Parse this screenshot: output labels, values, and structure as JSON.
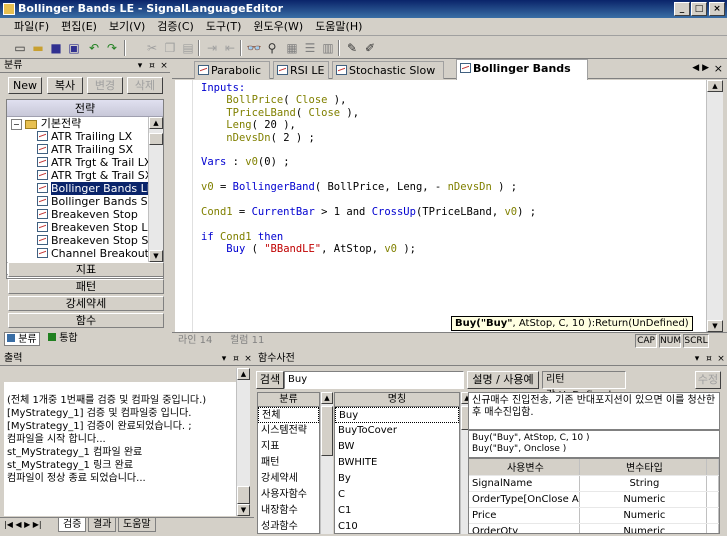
{
  "window": {
    "title": "Bollinger Bands LE - SignalLanguageEditor",
    "controls": [
      "_",
      "□",
      "×"
    ]
  },
  "menu": [
    "파일(F)",
    "편집(E)",
    "보기(V)",
    "검증(C)",
    "도구(T)",
    "윈도우(W)",
    "도움말(H)"
  ],
  "toolbar": [
    "new-file",
    "open",
    "save",
    "save-all",
    "undo",
    "redo",
    "cut",
    "copy",
    "paste",
    "indent",
    "outdent",
    "find",
    "find-next",
    "compile",
    "list",
    "window",
    "pen",
    "pen2"
  ],
  "left": {
    "title": "분류",
    "buttons": {
      "new": "New",
      "copy": "복사",
      "edit": "변경",
      "delete": "삭제"
    },
    "tree_header": "전략",
    "folder": "기본전략",
    "items": [
      "ATR Trailing LX",
      "ATR Trailing SX",
      "ATR Trgt & Trail LX",
      "ATR Trgt & Trail SX",
      "Bollinger Bands LE",
      "Bollinger Bands SE",
      "Breakeven Stop",
      "Breakeven Stop LX",
      "Breakeven Stop SX",
      "Channel Breakout LE"
    ],
    "selected_index": 4,
    "categories": [
      "지표",
      "패턴",
      "강세약세",
      "함수"
    ],
    "bottom_tabs": [
      "분류",
      "통합"
    ]
  },
  "editor": {
    "tabs": [
      "Parabolic LE",
      "RSI LE",
      "Stochastic Slow LE",
      "Bollinger Bands LE"
    ],
    "active_tab": 3,
    "tooltip_bold": "Buy(\"Buy\"",
    "tooltip_rest": ", AtStop, C, 10 ):Return(UnDefined)",
    "status": {
      "line": "라인 14",
      "col": "컬럼 11",
      "caps": "CAP",
      "num": "NUM",
      "scrl": "SCRL"
    }
  },
  "output": {
    "title": "출력",
    "lines": [
      "(전체 1개중 1번째를 검증 및 컴파일 중입니다.)",
      "[MyStrategy_1] 검증 및 컴파일중 입니다.",
      "[MyStrategy_1] 검증이 완료되었습니다. ;",
      "컴파일을 시작 합니다...",
      "st_MyStrategy_1 컴파일 완료",
      "st_MyStrategy_1 링크 완료",
      "컴파일이 정상 종료 되었습니다..."
    ],
    "tabs": [
      "검증",
      "결과",
      "도움말"
    ]
  },
  "func": {
    "title": "함수사전",
    "search_label": "검색",
    "search_value": "Buy",
    "desc_button": "설명 / 사용예",
    "return_label": "리턴값:UnDefined",
    "edit_button": "수정",
    "cat_header": "분류",
    "name_header": "명칭",
    "categories": [
      "전체",
      "시스템전략",
      "지표",
      "패턴",
      "강세약세",
      "사용자함수",
      "내장함수",
      "성과함수"
    ],
    "names": [
      "Buy",
      "BuyToCover",
      "BW",
      "BWHITE",
      "By",
      "C",
      "C1",
      "C10"
    ],
    "description": "신규매수 진입전송, 기존 반대포지션이 있으면 이를 청산한 후 매수진입함.",
    "examples": [
      "Buy(\"Buy\", AtStop, C, 10 )",
      "Buy(\"Buy\", Onclose )"
    ],
    "param_headers": [
      "사용변수",
      "변수타입"
    ],
    "params": [
      [
        "SignalName",
        "String"
      ],
      [
        "OrderType[OnClose A",
        "Numeric"
      ],
      [
        "Price",
        "Numeric"
      ],
      [
        "OrderQty",
        "Numeric"
      ]
    ]
  }
}
